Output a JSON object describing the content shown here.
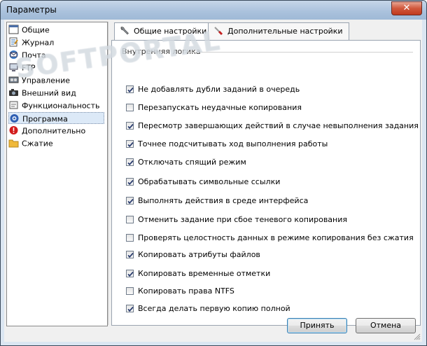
{
  "window": {
    "title": "Параметры",
    "close_label": "✕"
  },
  "tree": {
    "items": [
      {
        "label": "Общие",
        "icon": "window-icon"
      },
      {
        "label": "Журнал",
        "icon": "journal-icon"
      },
      {
        "label": "Почта",
        "icon": "mail-icon"
      },
      {
        "label": "FTP",
        "icon": "ftp-icon"
      },
      {
        "label": "Управление",
        "icon": "control-icon"
      },
      {
        "label": "Внешний вид",
        "icon": "camera-icon"
      },
      {
        "label": "Функциональность",
        "icon": "function-icon"
      },
      {
        "label": "Программа",
        "icon": "program-gear-icon",
        "selected": true
      },
      {
        "label": "Дополнительно",
        "icon": "alert-icon"
      },
      {
        "label": "Сжатие",
        "icon": "folder-icon"
      }
    ]
  },
  "tabs": [
    {
      "label": "Общие настройки",
      "icon": "wrench-icon",
      "active": true
    },
    {
      "label": "Дополнительные настройки",
      "icon": "screwdriver-icon",
      "active": false
    }
  ],
  "group": {
    "title": "Внутренняя логика"
  },
  "options": [
    {
      "label": "Не добавлять дубли заданий в очередь",
      "checked": true
    },
    {
      "label": "Перезапускать неудачные копирования",
      "checked": false
    },
    {
      "label": "Пересмотр завершающих действий в случае невыполнения задания",
      "checked": true
    },
    {
      "label": "Точнее подсчитывать ход выполнения работы",
      "checked": true
    },
    {
      "label": "Отключать спящий режим",
      "checked": true
    },
    {
      "label": "Обрабатывать символьные ссылки",
      "checked": true
    },
    {
      "label": "Выполнять действия в среде интерфейса",
      "checked": true
    },
    {
      "label": "Отменить задание при сбое теневого копирования",
      "checked": false
    },
    {
      "label": "Проверять целостность данных в режиме копирования без сжатия",
      "checked": false
    },
    {
      "label": "Копировать атрибуты файлов",
      "checked": true
    },
    {
      "label": "Копировать временные отметки",
      "checked": true
    },
    {
      "label": "Копировать права NTFS",
      "checked": false
    },
    {
      "label": "Всегда делать первую копию полной",
      "checked": true
    }
  ],
  "buttons": {
    "ok": "Принять",
    "cancel": "Отмена"
  }
}
